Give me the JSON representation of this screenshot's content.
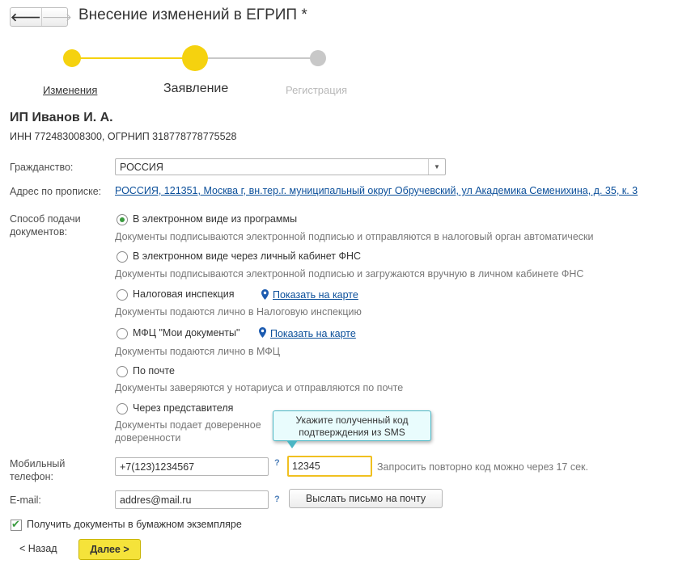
{
  "window": {
    "title": "Внесение изменений в ЕГРИП *",
    "back_icon": "back-arrow-icon",
    "forward_icon": "forward-arrow-icon"
  },
  "steps": [
    {
      "label": "Изменения",
      "state": "done"
    },
    {
      "label": "Заявление",
      "state": "current"
    },
    {
      "label": "Регистрация",
      "state": "pending"
    }
  ],
  "entrepreneur": {
    "name": "ИП Иванов И. А.",
    "ids": "ИНН 772483008300, ОГРНИП 318778778775528"
  },
  "citizenship": {
    "label": "Гражданство:",
    "value": "РОССИЯ"
  },
  "address": {
    "label": "Адрес по прописке:",
    "value": "РОССИЯ, 121351, Москва г, вн.тер.г. муниципальный округ Обручевский, ул Академика Семенихина, д. 35, к. 3"
  },
  "submission": {
    "label": "Способ подачи документов:",
    "options": [
      {
        "label": "В электронном виде из программы",
        "desc": "Документы подписываются электронной подписью и отправляются в налоговый орган автоматически",
        "selected": true
      },
      {
        "label": "В электронном виде через личный кабинет ФНС",
        "desc": "Документы подписываются электронной подписью и загружаются вручную в личном кабинете ФНС",
        "selected": false
      },
      {
        "label": "Налоговая инспекция",
        "desc": "Документы подаются лично в Налоговую инспекцию",
        "link": "Показать на карте",
        "selected": false
      },
      {
        "label": "МФЦ \"Мои документы\"",
        "desc": "Документы подаются лично в МФЦ",
        "link": "Показать на карте",
        "selected": false
      },
      {
        "label": "По почте",
        "desc": "Документы заверяются у нотариуса и отправляются по почте",
        "selected": false
      },
      {
        "label": "Через представителя",
        "desc": "Документы подает доверенное",
        "desc2": "доверенности",
        "selected": false
      }
    ]
  },
  "phone": {
    "label": "Мобильный телефон:",
    "value": "+7(123)1234567",
    "help": "?",
    "code": "12345",
    "resend_note": "Запросить повторно код можно через 17 сек."
  },
  "tooltip": {
    "text": "Укажите полученный код подтверждения из SMS"
  },
  "email": {
    "label": "E-mail:",
    "value": "addres@mail.ru",
    "help": "?",
    "send_button": "Выслать письмо на почту"
  },
  "paper_copy": {
    "label": "Получить документы в бумажном экземпляре",
    "checked": true
  },
  "footer": {
    "back": "< Назад",
    "next": "Далее >"
  },
  "colors": {
    "accent_yellow": "#f5d20f",
    "link": "#0b4f9a",
    "radio_selected": "#3a9b3f",
    "tooltip_border": "#4bb6c4"
  }
}
